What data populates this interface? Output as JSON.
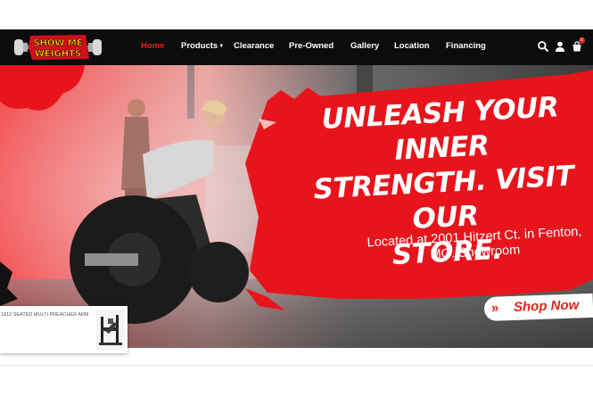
{
  "brand": {
    "logo_text_line1": "SHOW ME",
    "logo_text_line2": "WEIGHTS"
  },
  "nav": {
    "items": [
      {
        "label": "Home",
        "active": true
      },
      {
        "label": "Products",
        "has_dropdown": true
      },
      {
        "label": "Clearance"
      },
      {
        "label": "Pre-Owned"
      },
      {
        "label": "Gallery"
      },
      {
        "label": "Location"
      },
      {
        "label": "Financing"
      }
    ],
    "icons": [
      "search-icon",
      "user-icon",
      "cart-icon"
    ],
    "cart_count": "0"
  },
  "hero": {
    "headline_line1": "UNLEASH YOUR INNER",
    "headline_line2": "STRENGTH. VISIT OUR",
    "headline_line3": "STORE.",
    "subline_line1": "Located at 2001 Hitzert Ct. in Fenton,",
    "subline_line2": "MO. Showroom",
    "cta_label": "Shop Now",
    "cta_icon": "double-chevron-right-icon"
  },
  "popup": {
    "product_text": "1812 SEATED MULTI PREACHER ARM"
  },
  "colors": {
    "accent": "#e2231a",
    "nav_bg": "#0c0c0c"
  }
}
